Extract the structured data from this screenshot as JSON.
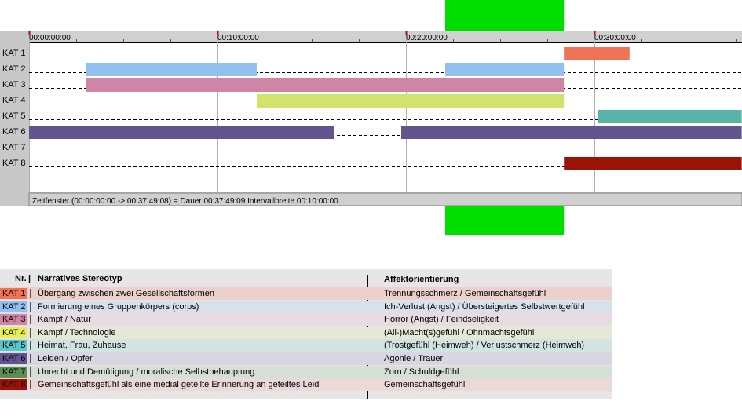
{
  "chart_data": {
    "type": "gantt",
    "time_ticks": [
      "00:00:00:00",
      "00:10:00:00",
      "00:20:00:00",
      "00:30:00:00"
    ],
    "time_range_seconds": [
      0,
      2269
    ],
    "categories": [
      "KAT 1",
      "KAT 2",
      "KAT 3",
      "KAT 4",
      "KAT 5",
      "KAT 6",
      "KAT 7",
      "KAT 8"
    ],
    "segments": [
      {
        "category": "KAT 1",
        "start": 1703,
        "end": 1912
      },
      {
        "category": "KAT 2",
        "start": 180,
        "end": 725
      },
      {
        "category": "KAT 2",
        "start": 1325,
        "end": 1703
      },
      {
        "category": "KAT 3",
        "start": 180,
        "end": 1703
      },
      {
        "category": "KAT 4",
        "start": 725,
        "end": 1703
      },
      {
        "category": "KAT 5",
        "start": 1810,
        "end": 2269
      },
      {
        "category": "KAT 6",
        "start": 0,
        "end": 970
      },
      {
        "category": "KAT 6",
        "start": 1185,
        "end": 2269
      },
      {
        "category": "KAT 8",
        "start": 1703,
        "end": 2269
      }
    ],
    "highlight": {
      "start": 1325,
      "end": 1703,
      "color": "#00dd00"
    },
    "status": "Zeitfenster (00:00:00:00 -> 00:37:49:08) = Dauer 00:37:49:09    Intervallbreite 00:10:00:00"
  },
  "colors": {
    "KAT 1": "#f07355",
    "KAT 2": "#92c0f0",
    "KAT 3": "#d084a6",
    "KAT 4": "#d2e26a",
    "KAT 5": "#58b3a9",
    "KAT 6": "#62548e",
    "KAT 7": "#5b8d55",
    "KAT 8": "#9a1208"
  },
  "legend": {
    "headers": {
      "nr": "Nr.",
      "stereotype": "Narratives Stereotyp",
      "affect": "Affektorientierung"
    },
    "rows": [
      {
        "badge": "KAT 1",
        "stereotype": "Übergang zwischen zwei Gesellschaftsformen",
        "affect": "Trennungsschmerz / Gemeinschaftsgefühl",
        "bg": "#ecd0cb",
        "badge_bg": "#f07355",
        "badge_fg": "#000000"
      },
      {
        "badge": "KAT 2",
        "stereotype": "Formierung eines Gruppenkörpers (corps)",
        "affect": "Ich-Verlust (Angst) / Übersteigertes Selbstwertgefühl",
        "bg": "#d7e1ec",
        "badge_bg": "#92c0f0",
        "badge_fg": "#000000"
      },
      {
        "badge": "KAT 3",
        "stereotype": "Kampf / Natur",
        "affect": "Horror (Angst) / Feindseligkeit",
        "bg": "#eadbe2",
        "badge_bg": "#d084a6",
        "badge_fg": "#000000"
      },
      {
        "badge": "KAT 4",
        "stereotype": "Kampf / Technologie",
        "affect": "(All-)Macht(s)gefühl / Ohnmachtsgefühl",
        "bg": "#e5e8d6",
        "badge_bg": "#e8ee5a",
        "badge_fg": "#000000"
      },
      {
        "badge": "KAT 5",
        "stereotype": "Heimat, Frau, Zuhause",
        "affect": "(Trostgefühl (Heimweh) / Verlustschmerz (Heimweh)",
        "bg": "#d2e3e1",
        "badge_bg": "#58c7c7",
        "badge_fg": "#000000"
      },
      {
        "badge": "KAT 6",
        "stereotype": "Leiden / Opfer",
        "affect": "Agonie / Trauer",
        "bg": "#d9d6e1",
        "badge_bg": "#62548e",
        "badge_fg": "#000000"
      },
      {
        "badge": "KAT 7",
        "stereotype": "Unrecht und Demütigung / moralische Selbstbehauptung",
        "affect": "Zorn / Schuldgefühl",
        "bg": "#d6dfd5",
        "badge_bg": "#5b8d55",
        "badge_fg": "#000000"
      },
      {
        "badge": "KAT 8",
        "stereotype": "Gemeinschaftsgefühl als eine medial geteilte Erinnerung an geteiltes Leid",
        "affect": "Gemeinschaftsgefühl",
        "bg": "#ead9d8",
        "badge_bg": "#9a1208",
        "badge_fg": "#000000"
      }
    ]
  }
}
